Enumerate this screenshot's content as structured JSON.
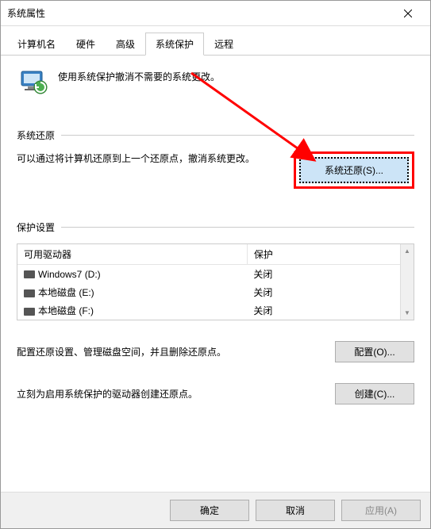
{
  "titlebar": {
    "title": "系统属性"
  },
  "tabs": [
    {
      "label": "计算机名"
    },
    {
      "label": "硬件"
    },
    {
      "label": "高级"
    },
    {
      "label": "系统保护",
      "active": true
    },
    {
      "label": "远程"
    }
  ],
  "intro": "使用系统保护撤消不需要的系统更改。",
  "restore": {
    "section": "系统还原",
    "text": "可以通过将计算机还原到上一个还原点，撤消系统更改。",
    "button": "系统还原(S)..."
  },
  "protection": {
    "section": "保护设置",
    "columns": {
      "drive": "可用驱动器",
      "status": "保护"
    },
    "drives": [
      {
        "name": "Windows7 (D:)",
        "status": "关闭"
      },
      {
        "name": "本地磁盘 (E:)",
        "status": "关闭"
      },
      {
        "name": "本地磁盘 (F:)",
        "status": "关闭"
      }
    ],
    "configText": "配置还原设置、管理磁盘空间，并且删除还原点。",
    "configBtn": "配置(O)...",
    "createText": "立刻为启用系统保护的驱动器创建还原点。",
    "createBtn": "创建(C)..."
  },
  "footer": {
    "ok": "确定",
    "cancel": "取消",
    "apply": "应用(A)"
  }
}
